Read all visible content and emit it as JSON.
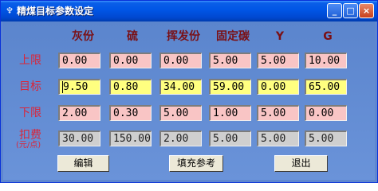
{
  "window": {
    "title": "精煤目标参数设定",
    "icon": "app-icon"
  },
  "title_buttons": {
    "minimize": "_",
    "maximize": "□",
    "close": "×"
  },
  "columns": [
    "灰份",
    "硫",
    "挥发份",
    "固定碳",
    "Y",
    "G"
  ],
  "rows": [
    {
      "label": "上限",
      "values": [
        "0.00",
        "0.00",
        "0.00",
        "5.00",
        "5.00",
        "10.00"
      ],
      "style": "pink"
    },
    {
      "label": "目标",
      "values": [
        "9.50",
        "0.80",
        "34.00",
        "59.00",
        "0.00",
        "65.00"
      ],
      "style": "yellow"
    },
    {
      "label": "下限",
      "values": [
        "2.00",
        "0.30",
        "5.00",
        "1.00",
        "5.00",
        "0.00"
      ],
      "style": "pink"
    },
    {
      "label": "扣费",
      "sublabel": "(元/点)",
      "values": [
        "30.00",
        "150.00",
        "2.00",
        "5.00",
        "5.00",
        "5.00"
      ],
      "style": "gray"
    }
  ],
  "buttons": {
    "edit": "编辑",
    "fill_reference": "填充参考",
    "exit": "退出"
  },
  "colors": {
    "title_bar": "#0055e5",
    "client_bg": "#6a93d9",
    "header_text": "#7a0f14",
    "row_label": "#d9263a",
    "field_pink": "#f9c5c5",
    "field_yellow": "#ffff80",
    "field_gray": "#cfcfcf"
  }
}
